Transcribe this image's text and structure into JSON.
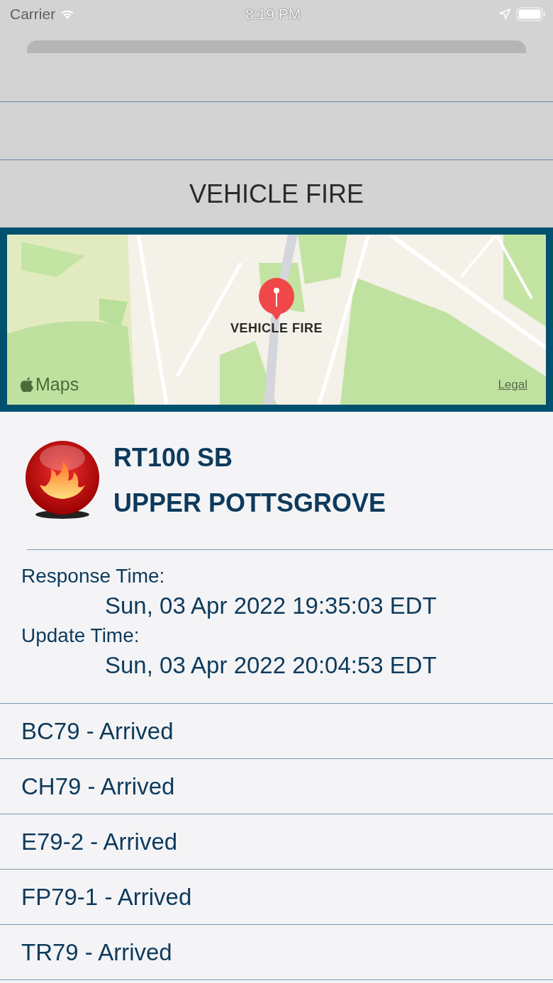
{
  "status_bar": {
    "carrier": "Carrier",
    "time": "8:19 PM"
  },
  "title": "VEHICLE FIRE",
  "map": {
    "pin_label": "VEHICLE FIRE",
    "attribution": "Maps",
    "legal": "Legal"
  },
  "incident": {
    "location": "RT100 SB",
    "municipality": "UPPER POTTSGROVE"
  },
  "times": [
    {
      "label": "Response Time:",
      "value": "Sun, 03 Apr 2022 19:35:03 EDT"
    },
    {
      "label": "Update Time:",
      "value": "Sun, 03 Apr 2022 20:04:53 EDT"
    }
  ],
  "units": [
    "BC79 - Arrived",
    "CH79 - Arrived",
    "E79-2 - Arrived",
    "FP79-1 - Arrived",
    "TR79 - Arrived"
  ]
}
